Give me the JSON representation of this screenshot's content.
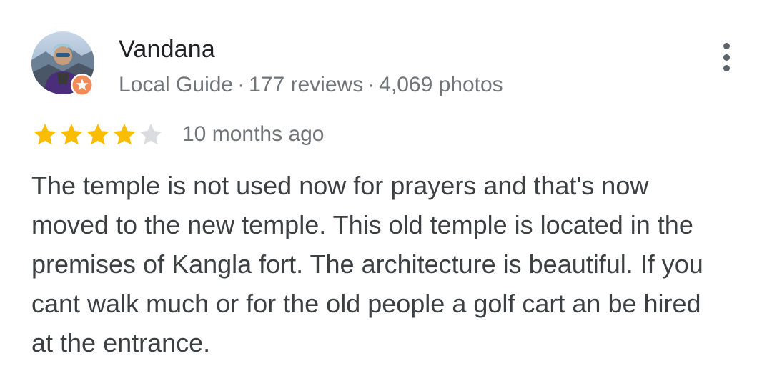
{
  "reviewer": {
    "name": "Vandana",
    "guide_label": "Local Guide",
    "separator": "·",
    "reviews": "177 reviews",
    "photos": "4,069 photos",
    "avatar_icon": "user-avatar-photo",
    "badge_icon": "local-guide-badge-icon"
  },
  "rating": {
    "value": 4,
    "max": 5,
    "time": "10 months ago",
    "filled_color": "#fbbc04",
    "empty_color": "#dadce0"
  },
  "review": {
    "text": "The temple is not used now for prayers and that's now moved to the new temple. This old temple is located in the premises of Kangla fort. The architecture is beautiful. If you cant walk much or for the old people a golf cart an be hired at the entrance."
  },
  "menu": {
    "icon": "more-vert-icon"
  },
  "colors": {
    "text_primary": "#202124",
    "text_secondary": "#70757a",
    "badge": "#f28b57"
  }
}
